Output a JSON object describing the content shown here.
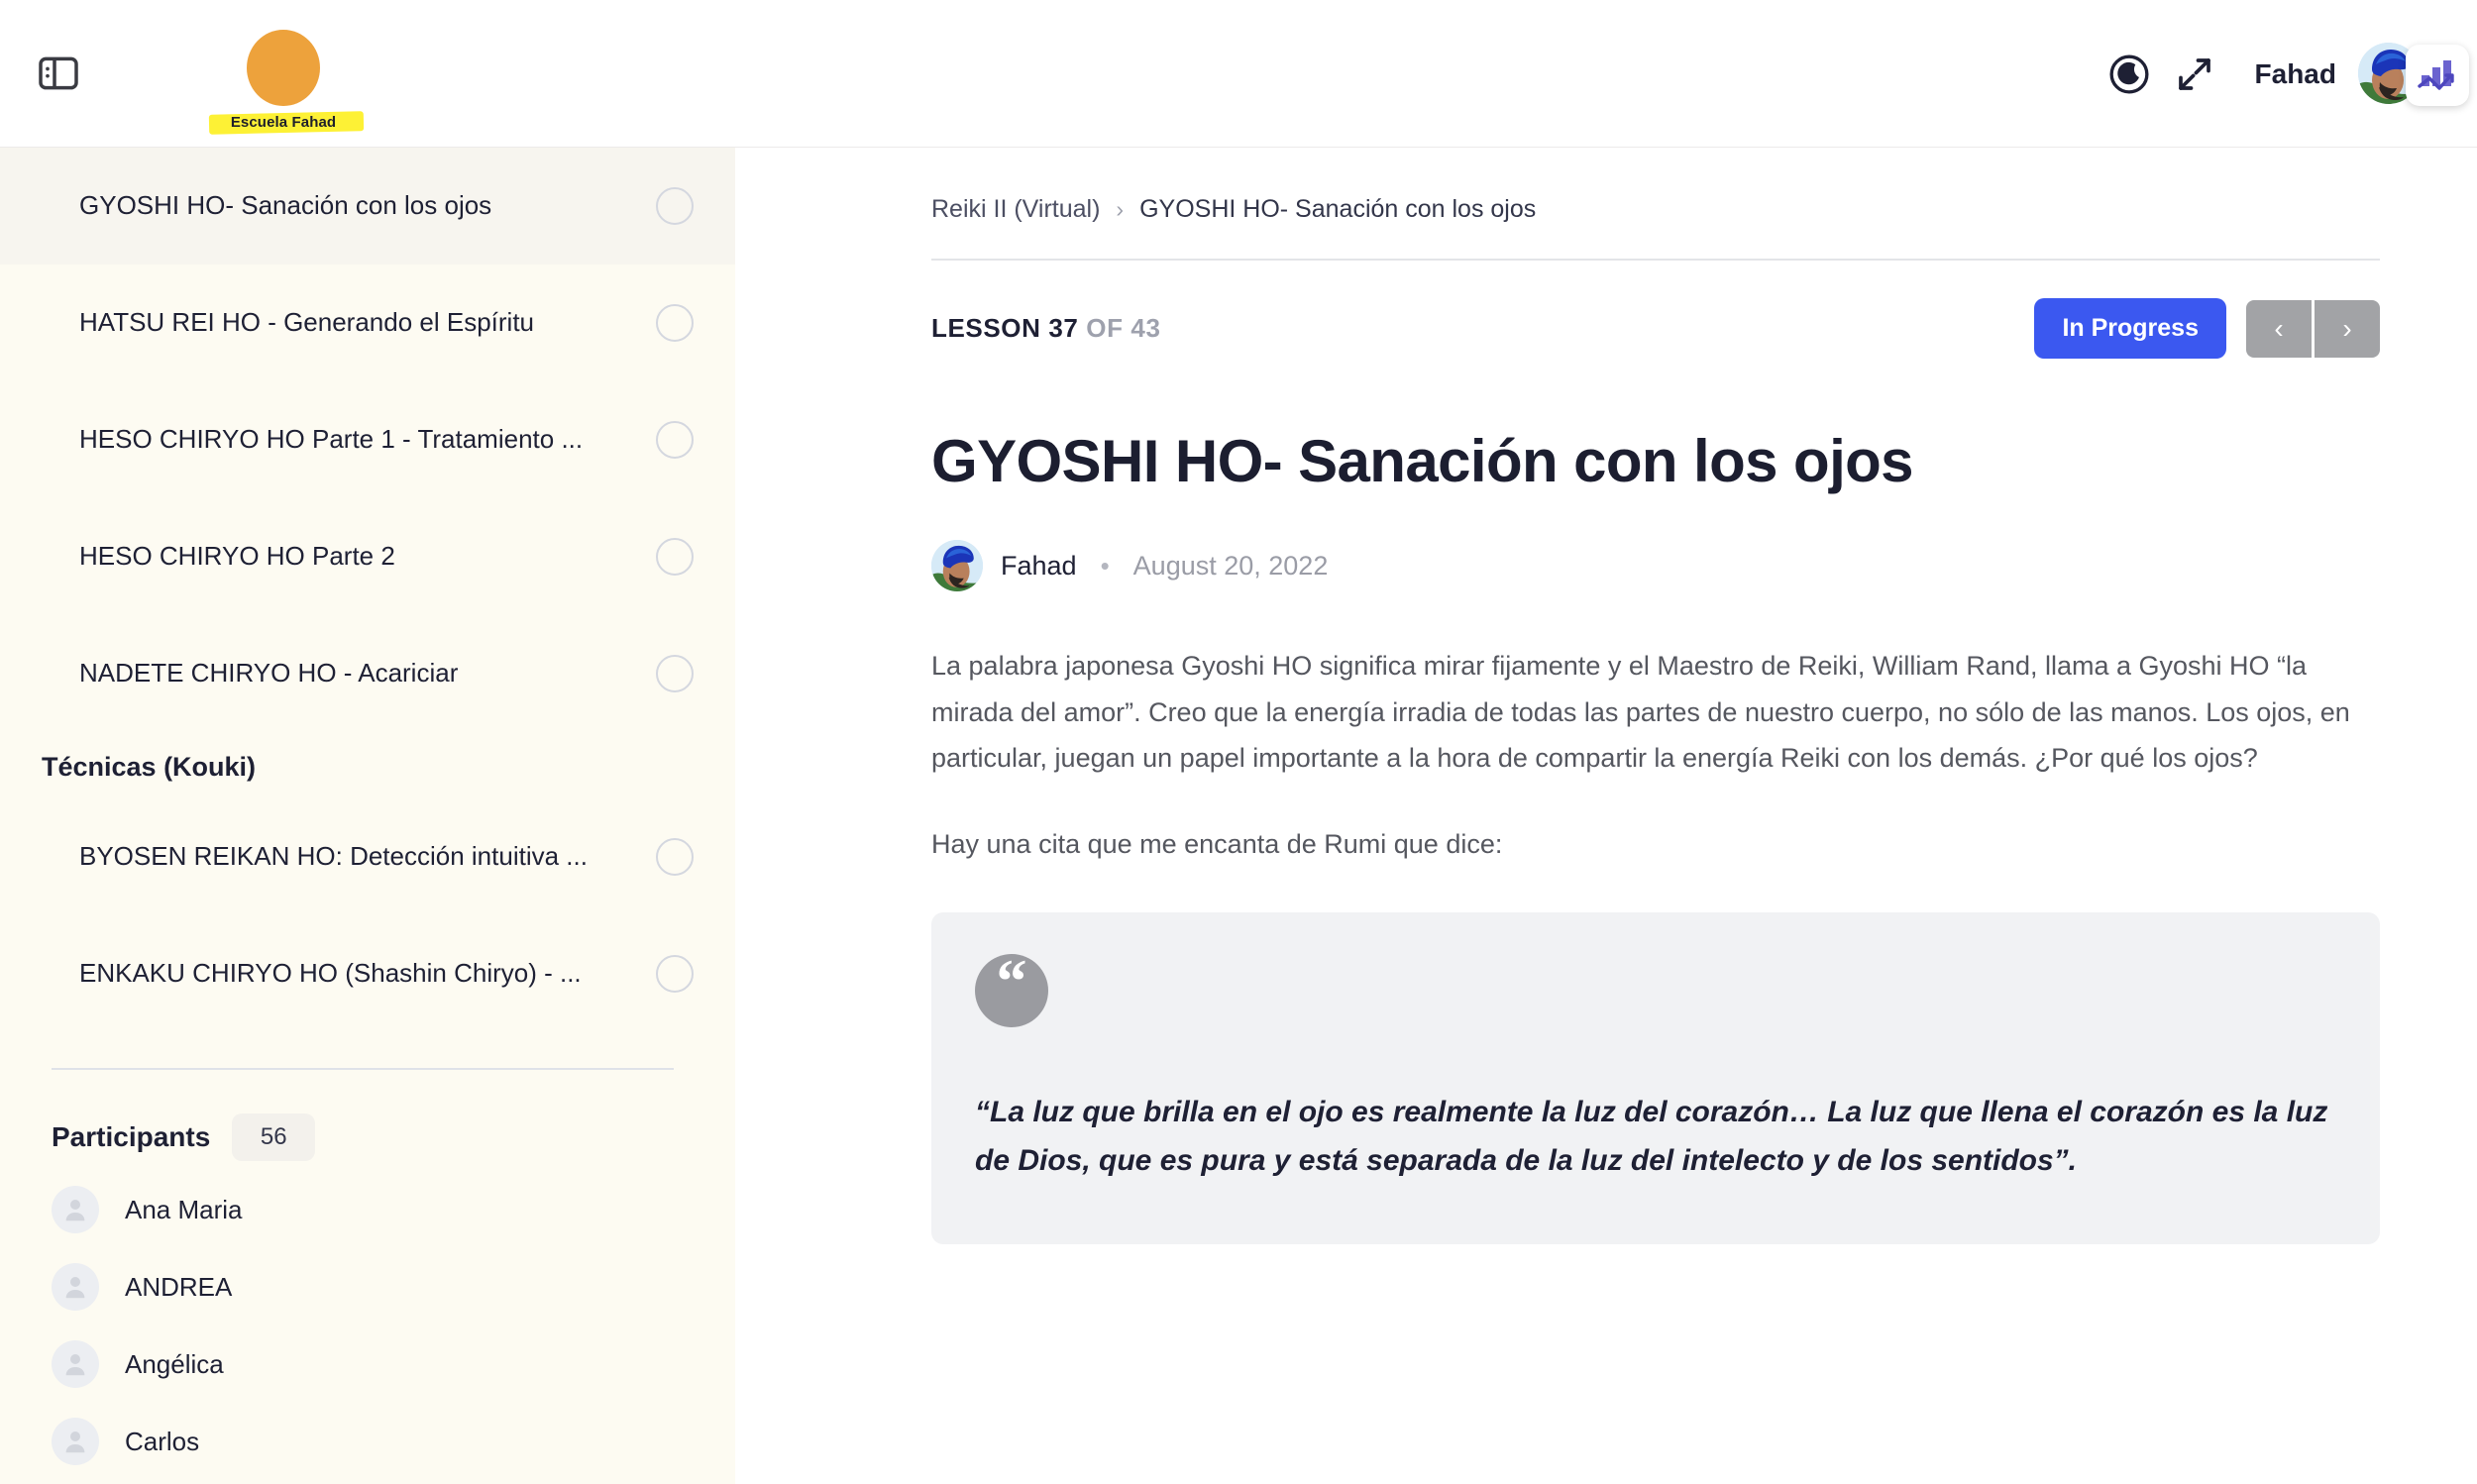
{
  "header": {
    "sidebar_toggle_icon": "sidebar-toggle-icon",
    "brand_name": "Escuela Fahad",
    "dark_mode_icon": "moon-icon",
    "fullscreen_icon": "expand-arrows-icon",
    "user_name": "Fahad",
    "avatar_icon": "user-avatar",
    "app_badge_icon": "bar-chart-app-icon"
  },
  "sidebar": {
    "lessons": [
      {
        "label": "GYOSHI HO- Sanación con los ojos",
        "active": true
      },
      {
        "label": "HATSU REI HO - Generando el Espíritu",
        "active": false
      },
      {
        "label": "HESO CHIRYO HO Parte 1 - Tratamiento ...",
        "active": false
      },
      {
        "label": "HESO CHIRYO HO Parte 2",
        "active": false
      },
      {
        "label": "NADETE CHIRYO HO - Acariciar",
        "active": false
      }
    ],
    "section_title": "Técnicas (Kouki)",
    "section_lessons": [
      {
        "label": "BYOSEN REIKAN HO: Detección intuitiva ...",
        "active": false
      },
      {
        "label": "ENKAKU CHIRYO HO (Shashin Chiryo) - ...",
        "active": false
      }
    ],
    "participants_title": "Participants",
    "participants_count": "56",
    "participants": [
      {
        "name": "Ana Maria"
      },
      {
        "name": "ANDREA"
      },
      {
        "name": "Angélica"
      },
      {
        "name": "Carlos"
      }
    ]
  },
  "main": {
    "breadcrumb": {
      "parent": "Reiki II (Virtual)",
      "separator": "›",
      "current": "GYOSHI HO- Sanación con los ojos"
    },
    "lesson_label": "LESSON 37",
    "lesson_total": "OF 43",
    "progress_button": "In Progress",
    "prev_button": "‹",
    "next_button": "›",
    "title": "GYOSHI HO- Sanación con los ojos",
    "author": "Fahad",
    "byline_dot": "•",
    "date": "August 20, 2022",
    "paragraph_1": "La palabra japonesa Gyoshi HO significa mirar fijamente y el Maestro de Reiki, William Rand, llama a Gyoshi HO “la mirada del amor”.  Creo que la energía irradia de todas las partes de nuestro cuerpo, no sólo de las manos.  Los ojos, en particular, juegan un papel importante a la hora de compartir la energía Reiki con los demás.   ¿Por qué los ojos?",
    "paragraph_2": " Hay una cita que me encanta de Rumi que dice:",
    "quote_icon": "quote-mark-icon",
    "quote_text": "“La luz que brilla en el ojo es realmente la luz del corazón… La luz que llena el corazón es la luz de Dios, que es pura y está separada de la luz del intelecto y de los sentidos”."
  },
  "colors": {
    "accent_blue": "#3b58f0",
    "sidebar_bg": "#fdfbf2",
    "brand_orange": "#eda23c",
    "highlight_yellow": "#fdf135",
    "nav_gray": "#a2a3a6",
    "quote_bg": "#f1f2f4"
  }
}
